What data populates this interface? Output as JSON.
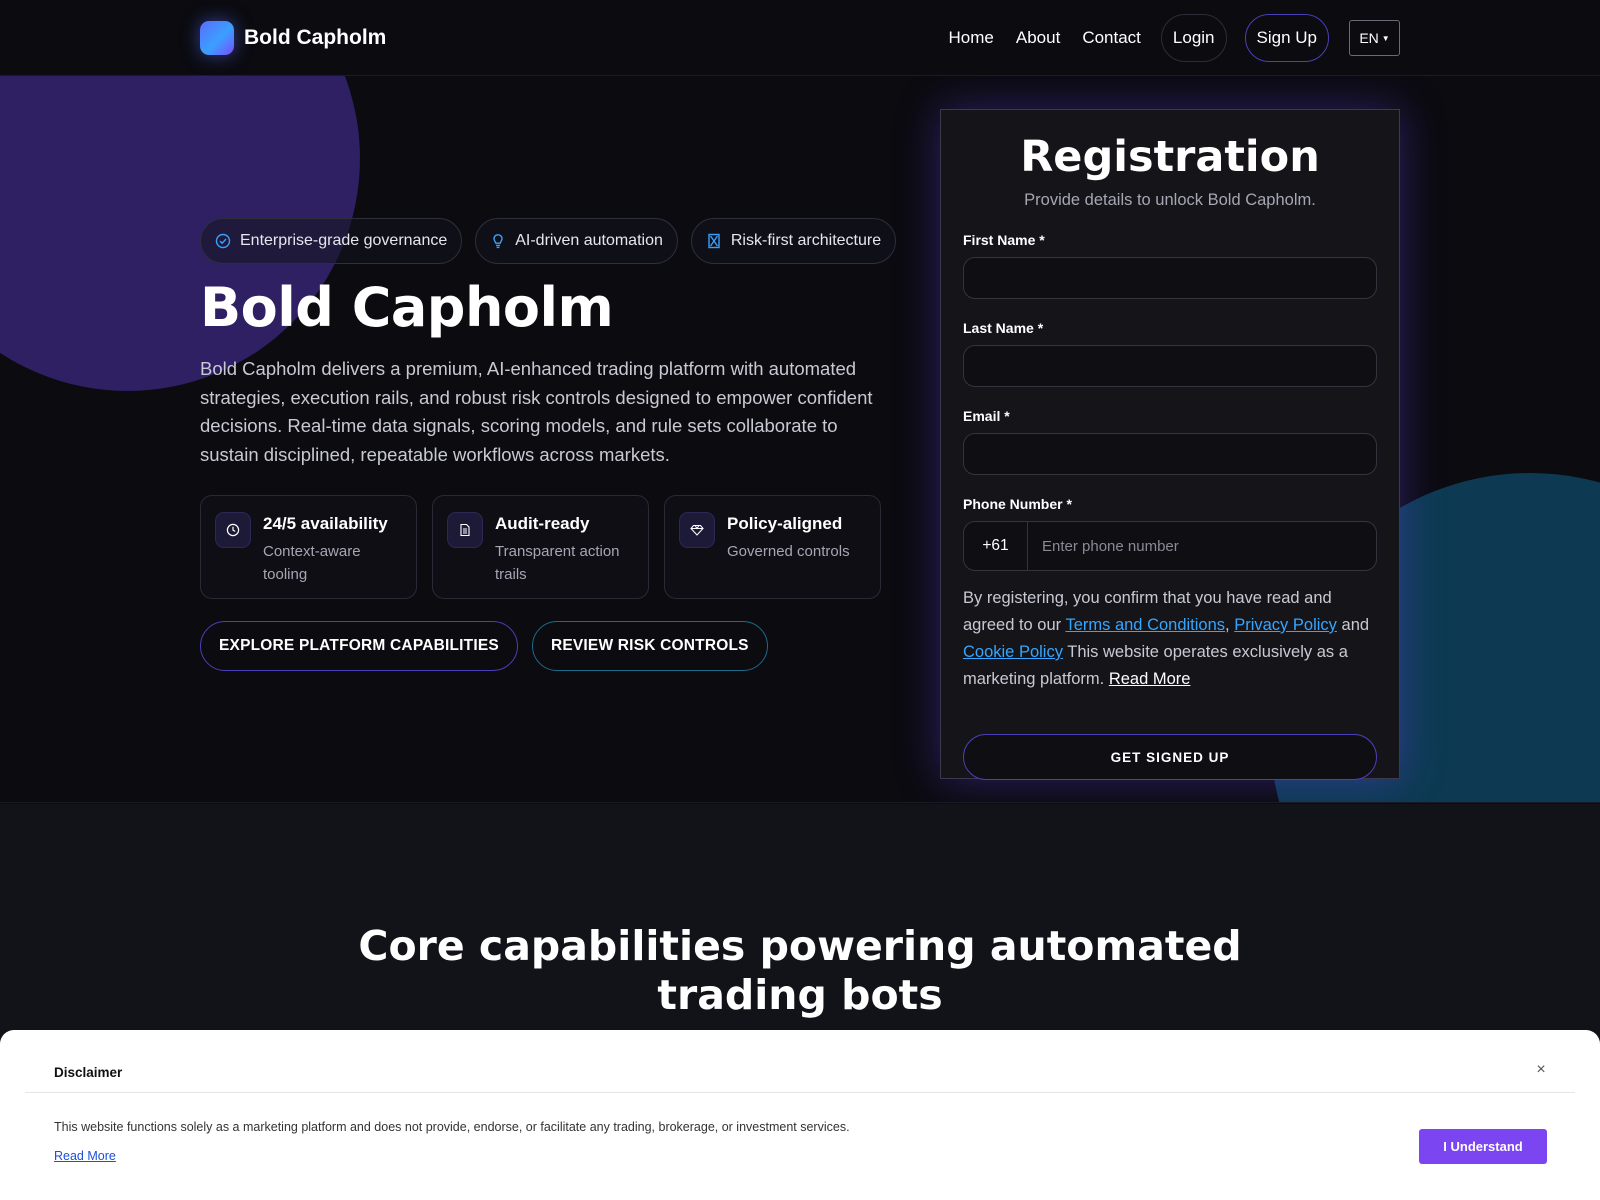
{
  "navbar": {
    "brand": "Bold Capholm",
    "links": [
      "Home",
      "About",
      "Contact"
    ],
    "login_label": "Login",
    "signup_label": "Sign Up",
    "language": "EN"
  },
  "hero": {
    "badges": [
      {
        "label": "Enterprise-grade governance",
        "icon": "check-circle-icon"
      },
      {
        "label": "AI-driven automation",
        "icon": "lightbulb-icon"
      },
      {
        "label": "Risk-first architecture",
        "icon": "hourglass-icon"
      }
    ],
    "title": "Bold Capholm",
    "description": "Bold Capholm delivers a premium, AI-enhanced trading platform with automated strategies, execution rails, and robust risk controls designed to empower confident decisions. Real-time data signals, scoring models, and rule sets collaborate to sustain disciplined, repeatable workflows across markets.",
    "features": [
      {
        "title": "24/5 availability",
        "subtitle": "Context-aware tooling",
        "icon": "clock-icon"
      },
      {
        "title": "Audit-ready",
        "subtitle": "Transparent action trails",
        "icon": "document-icon"
      },
      {
        "title": "Policy-aligned",
        "subtitle": "Governed controls",
        "icon": "diamond-icon"
      }
    ],
    "cta_primary": "EXPLORE PLATFORM CAPABILITIES",
    "cta_secondary": "REVIEW RISK CONTROLS"
  },
  "registration": {
    "title": "Registration",
    "subtitle": "Provide details to unlock Bold Capholm.",
    "first_name_label": "First Name *",
    "first_name_value": "",
    "last_name_label": "Last Name *",
    "last_name_value": "",
    "email_label": "Email *",
    "email_value": "",
    "phone_label": "Phone Number *",
    "phone_code": "+61",
    "phone_placeholder": "Enter phone number",
    "consent_prefix": "By registering, you confirm that you have read and agreed to our",
    "terms_label": "Terms and Conditions",
    "comma": ",",
    "privacy_label": "Privacy Policy",
    "and_label": "and",
    "cookie_label": "Cookie Policy",
    "consent_suffix": "This website operates exclusively as a marketing platform.",
    "read_more_label": "Read More",
    "submit_label": "GET SIGNED UP"
  },
  "section2": {
    "title_line1": "Core capabilities powering automated",
    "title_line2": "trading bots"
  },
  "disclaimer": {
    "title": "Disclaimer",
    "close_icon": "×",
    "text": "This website functions solely as a marketing platform and does not provide, endorse, or facilitate any trading, brokerage, or investment services.",
    "read_more": "Read More",
    "button_label": "I Understand"
  },
  "colors": {
    "background": "#0b0b10",
    "accent_purple": "#7b46f2",
    "accent_teal": "#0d3a52",
    "link_blue": "#35a6ff"
  }
}
